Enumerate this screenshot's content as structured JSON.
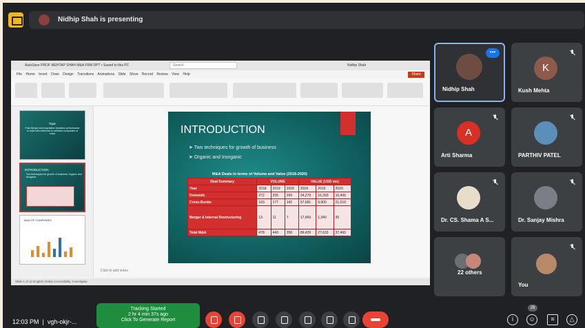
{
  "header": {
    "presenter_text": "Nidhip Shah is presenting"
  },
  "ppt": {
    "window_title": "AutoSave  PROF MEHTAP SHAH M&A FRM DPT • Saved to this PC",
    "search_placeholder": "Search",
    "user": "Nidhip Shah",
    "menu": "File   Home   Insert   Draw   Design   Transitions   Animations   Slide Show   Record   Review   View   Help",
    "share_label": "Share",
    "notes_placeholder": "Click to add notes",
    "status_text": "Slide 1 of 12     English (India)     Accessibility: Investigate"
  },
  "thumbnails": [
    {
      "title": "Topic",
      "text": "Post Merger and Acquisition business performance in India with reference to selected companies of India"
    },
    {
      "title": "INTRODUCTION",
      "text": "Two techniques for growth of business; Organic and Inorganic"
    },
    {
      "title": "M&A OF COMPANIES",
      "text": ""
    }
  ],
  "slide": {
    "title": "INTRODUCTION",
    "bullets": [
      "Two techniques for growth of business",
      "Organic and Inorganic"
    ],
    "table_caption": "M&A Deals in terms of Volume and Value (2018-2020)",
    "table": {
      "header": [
        "Deal Summary",
        "VOLUME",
        "VALUE (USD mn)"
      ],
      "years": [
        "Year",
        "2018",
        "2019",
        "2020",
        "2018",
        "2019",
        "2020"
      ],
      "rows": [
        [
          "Domestic",
          "272",
          "255",
          "209",
          "34,279",
          "16,393",
          "16,406"
        ],
        [
          "Cross-Border",
          "193",
          "177",
          "142",
          "57,681",
          "9,900",
          "21,019"
        ],
        [
          "Merger & Internal Restructuring",
          "13",
          "11",
          "7",
          "17,469",
          "1,340",
          "35"
        ],
        [
          "Total M&A",
          "478",
          "443",
          "358",
          "89,429",
          "27,633",
          "37,460"
        ]
      ]
    }
  },
  "participants": [
    {
      "name": "Nidhip Shah",
      "initial": "",
      "color": "#6d4c41",
      "muted": false,
      "highlight": true
    },
    {
      "name": "Kush Mehta",
      "initial": "K",
      "color": "#8d5a4c",
      "muted": true,
      "highlight": false
    },
    {
      "name": "Arti Sharma",
      "initial": "A",
      "color": "#d93025",
      "muted": true,
      "highlight": false
    },
    {
      "name": "PARTHIV PATEL",
      "initial": "",
      "color": "#5b8fb9",
      "muted": true,
      "highlight": false
    },
    {
      "name": "Dr. CS. Shama A S...",
      "initial": "",
      "color": "#e8dccb",
      "muted": true,
      "highlight": false
    },
    {
      "name": "Dr. Sanjay Mishra",
      "initial": "",
      "color": "#7a7f86",
      "muted": true,
      "highlight": false
    },
    {
      "name": "22 others",
      "initial": "",
      "color": "#6b6e72",
      "muted": false,
      "highlight": false
    },
    {
      "name": "You",
      "initial": "",
      "color": "#b88a6a",
      "muted": true,
      "highlight": false
    }
  ],
  "footer": {
    "time": "12:03 PM",
    "meeting_code": "vgh-okjr-...",
    "tracking_line1": "Tracking Started",
    "tracking_line2": "2 hr 4 min 37s ago",
    "tracking_line3": "Click To Generate Report",
    "participant_count": "28",
    "right_icons": [
      "info-icon",
      "people-icon",
      "chat-icon",
      "activities-icon"
    ]
  }
}
